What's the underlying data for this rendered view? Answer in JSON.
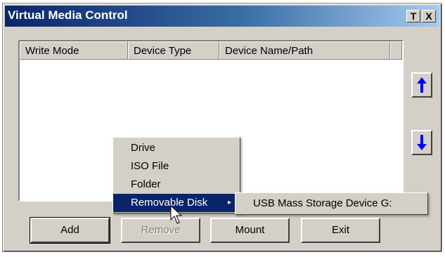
{
  "window": {
    "title": "Virtual Media Control",
    "title_buttons": [
      "T",
      "X"
    ]
  },
  "list": {
    "columns": [
      "Write Mode",
      "Device Type",
      "Device Name/Path"
    ],
    "rows": []
  },
  "move_up_icon": "up-arrow-icon",
  "move_down_icon": "down-arrow-icon",
  "buttons": {
    "add": "Add",
    "remove": "Remove",
    "mount": "Mount",
    "exit": "Exit"
  },
  "context_menu": {
    "items": [
      "Drive",
      "ISO File",
      "Folder",
      "Removable Disk"
    ],
    "selected": "Removable Disk",
    "submenu_arrow": "▸"
  },
  "submenu": {
    "items": [
      "USB Mass Storage Device G:"
    ]
  },
  "colors": {
    "titlebar_start": "#0a246a",
    "titlebar_end": "#a6caf0",
    "face": "#d4d0c8",
    "highlight": "#0a246a",
    "arrow_blue": "#0000ff"
  }
}
